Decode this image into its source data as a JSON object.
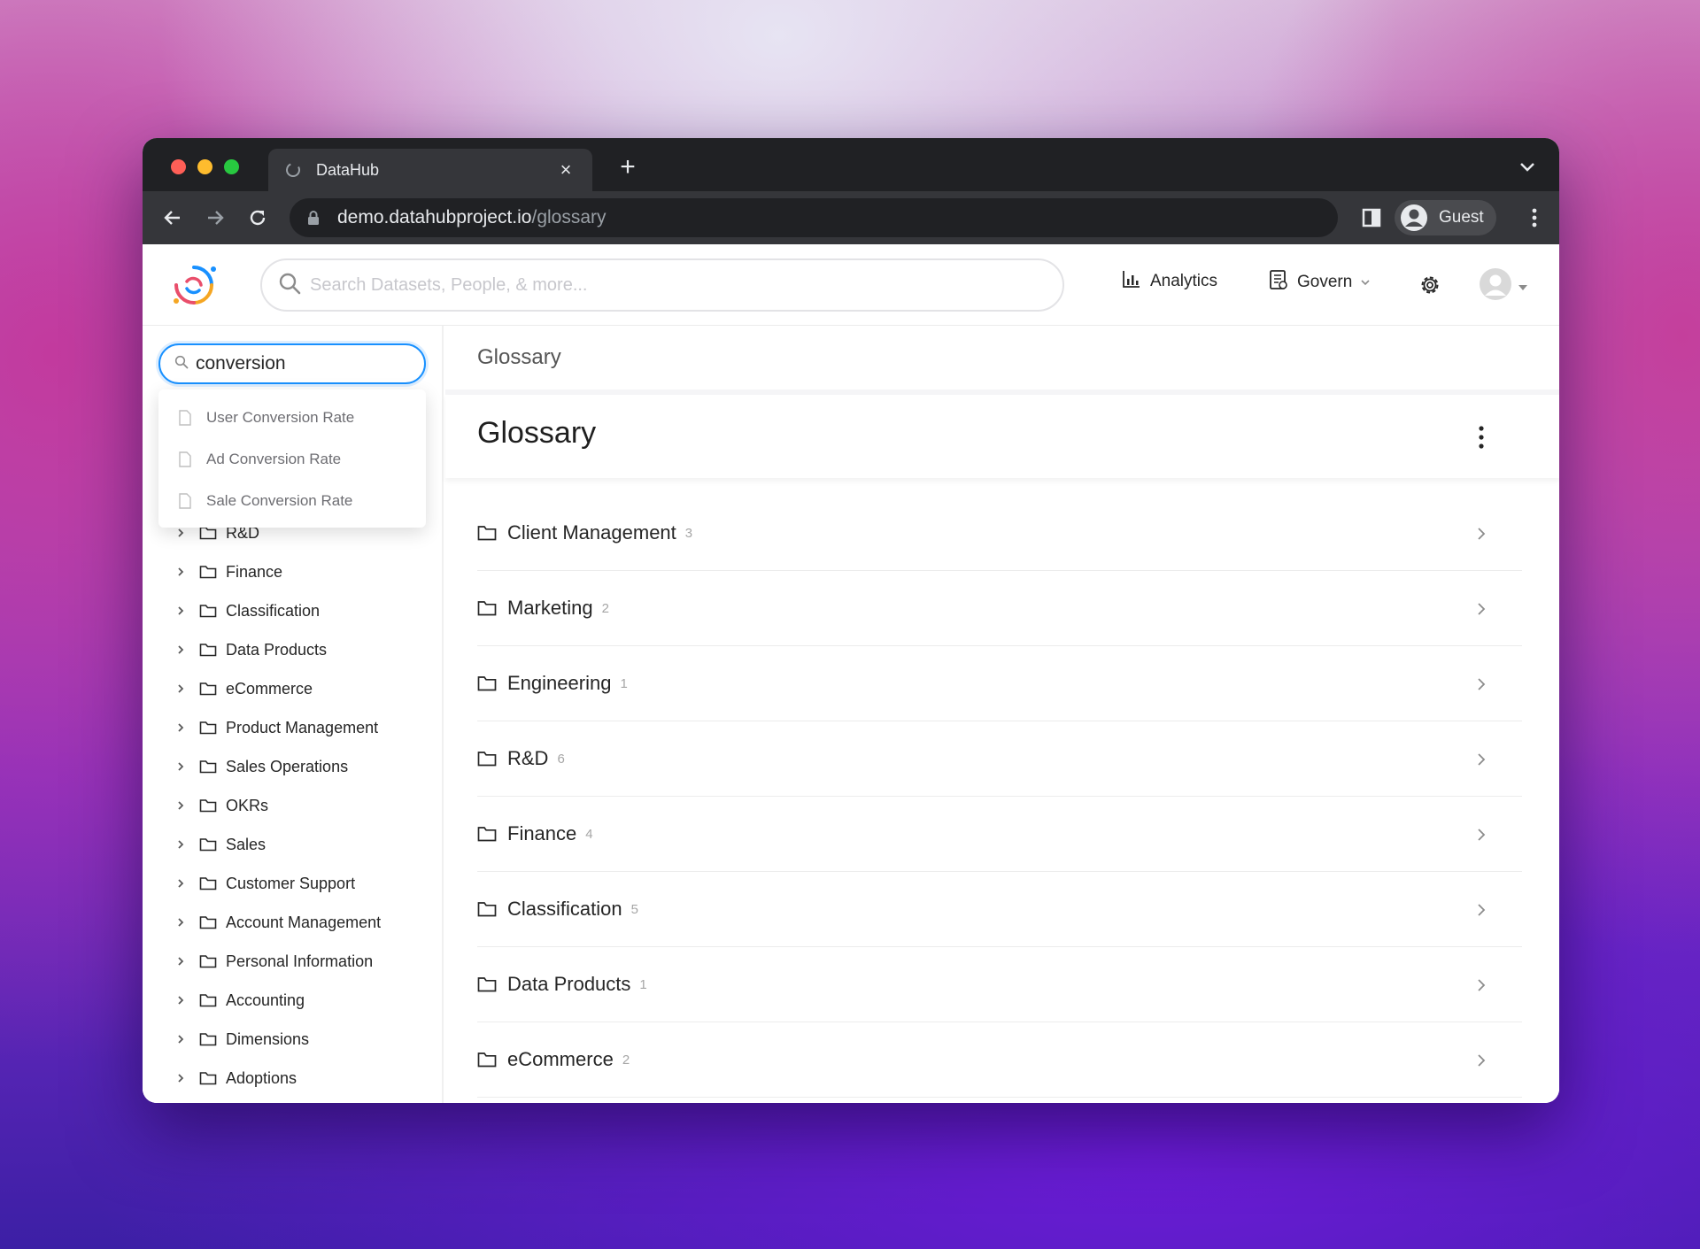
{
  "browser": {
    "tab_title": "DataHub",
    "tab_close": "×",
    "new_tab": "+",
    "url_host": "demo.datahubproject.io",
    "url_path": "/glossary",
    "profile_label": "Guest"
  },
  "header": {
    "search_placeholder": "Search Datasets, People, & more...",
    "analytics_label": "Analytics",
    "govern_label": "Govern"
  },
  "sidebar": {
    "search_value": "conversion",
    "suggestions": [
      "User Conversion Rate",
      "Ad Conversion Rate",
      "Sale Conversion Rate"
    ],
    "tree": [
      "R&D",
      "Finance",
      "Classification",
      "Data Products",
      "eCommerce",
      "Product Management",
      "Sales Operations",
      "OKRs",
      "Sales",
      "Customer Support",
      "Account Management",
      "Personal Information",
      "Accounting",
      "Dimensions",
      "Adoptions"
    ]
  },
  "main": {
    "breadcrumb": "Glossary",
    "title": "Glossary",
    "nodes": [
      {
        "label": "Client Management",
        "count": "3"
      },
      {
        "label": "Marketing",
        "count": "2"
      },
      {
        "label": "Engineering",
        "count": "1"
      },
      {
        "label": "R&D",
        "count": "6"
      },
      {
        "label": "Finance",
        "count": "4"
      },
      {
        "label": "Classification",
        "count": "5"
      },
      {
        "label": "Data Products",
        "count": "1"
      },
      {
        "label": "eCommerce",
        "count": "2"
      }
    ]
  },
  "colors": {
    "accent": "#1890ff",
    "chrome_dark": "#202124",
    "chrome_mid": "#35363a"
  },
  "icons": [
    "datahub-logo-icon",
    "search-icon",
    "analytics-icon",
    "govern-icon",
    "gear-icon",
    "avatar-icon",
    "folder-icon",
    "chevron-right-icon",
    "kebab-icon",
    "document-icon"
  ]
}
